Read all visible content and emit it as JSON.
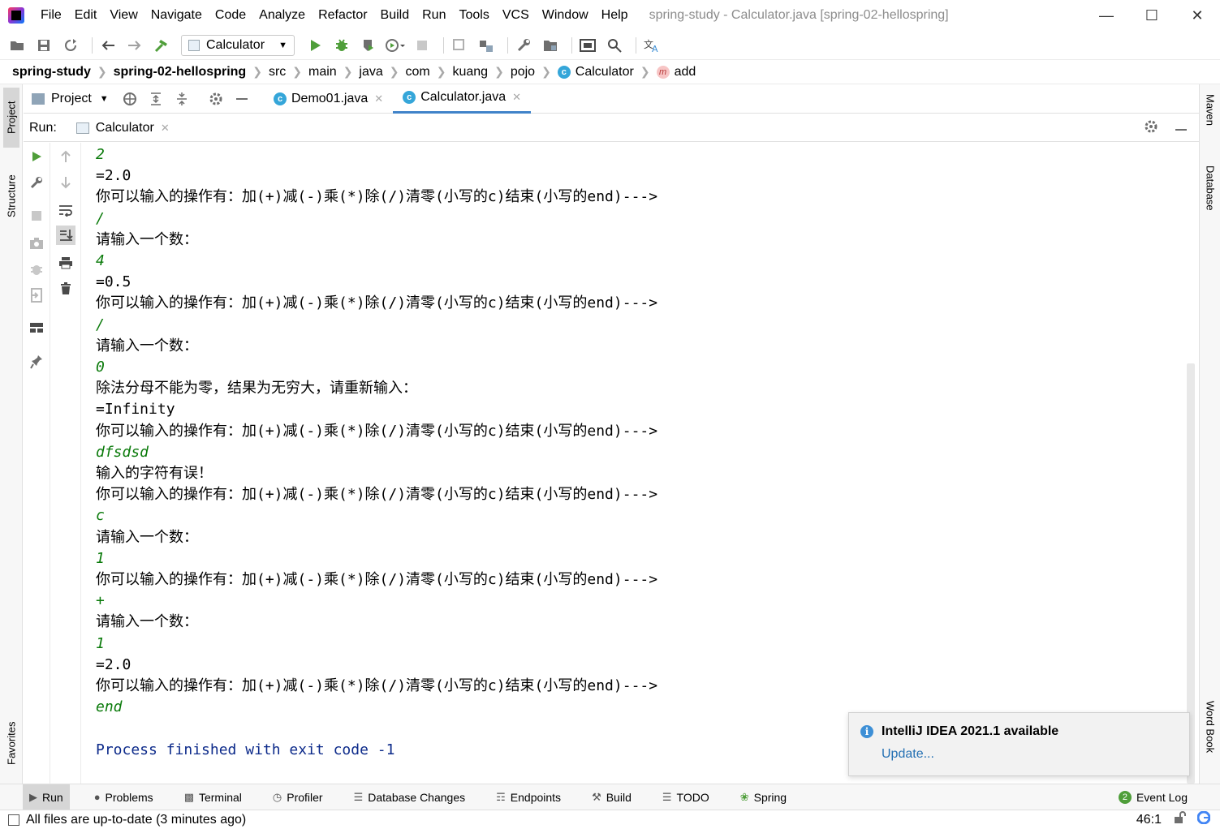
{
  "menu": [
    "File",
    "Edit",
    "View",
    "Navigate",
    "Code",
    "Analyze",
    "Refactor",
    "Build",
    "Run",
    "Tools",
    "VCS",
    "Window",
    "Help"
  ],
  "window_title": "spring-study - Calculator.java [spring-02-hellospring]",
  "toolbar": {
    "run_config": "Calculator"
  },
  "breadcrumb": [
    "spring-study",
    "spring-02-hellospring",
    "src",
    "main",
    "java",
    "com",
    "kuang",
    "pojo",
    "Calculator",
    "add"
  ],
  "left_stripe": {
    "project": "Project",
    "structure": "Structure",
    "favorites": "Favorites"
  },
  "right_stripe": {
    "maven": "Maven",
    "database": "Database",
    "word_book": "Word Book"
  },
  "tabs_row": {
    "project_label": "Project",
    "tabs": [
      "Demo01.java",
      "Calculator.java"
    ]
  },
  "run_header": {
    "label": "Run:",
    "tab": "Calculator"
  },
  "console": [
    {
      "t": "2",
      "k": "in"
    },
    {
      "t": "=2.0",
      "k": "out"
    },
    {
      "t": "你可以输入的操作有：加(+)减(-)乘(*)除(/)清零(小写的c)结束(小写的end)--->",
      "k": "out"
    },
    {
      "t": "/",
      "k": "in"
    },
    {
      "t": "请输入一个数：",
      "k": "out"
    },
    {
      "t": "4",
      "k": "in"
    },
    {
      "t": "=0.5",
      "k": "out"
    },
    {
      "t": "你可以输入的操作有：加(+)减(-)乘(*)除(/)清零(小写的c)结束(小写的end)--->",
      "k": "out"
    },
    {
      "t": "/",
      "k": "in"
    },
    {
      "t": "请输入一个数：",
      "k": "out"
    },
    {
      "t": "0",
      "k": "in"
    },
    {
      "t": "除法分母不能为零，结果为无穷大，请重新输入：",
      "k": "out"
    },
    {
      "t": "=Infinity",
      "k": "out"
    },
    {
      "t": "你可以输入的操作有：加(+)减(-)乘(*)除(/)清零(小写的c)结束(小写的end)--->",
      "k": "out"
    },
    {
      "t": "dfsdsd",
      "k": "in"
    },
    {
      "t": "输入的字符有误！",
      "k": "out"
    },
    {
      "t": "你可以输入的操作有：加(+)减(-)乘(*)除(/)清零(小写的c)结束(小写的end)--->",
      "k": "out"
    },
    {
      "t": "c",
      "k": "in"
    },
    {
      "t": "请输入一个数：",
      "k": "out"
    },
    {
      "t": "1",
      "k": "in"
    },
    {
      "t": "你可以输入的操作有：加(+)减(-)乘(*)除(/)清零(小写的c)结束(小写的end)--->",
      "k": "out"
    },
    {
      "t": "+",
      "k": "in"
    },
    {
      "t": "请输入一个数：",
      "k": "out"
    },
    {
      "t": "1",
      "k": "in"
    },
    {
      "t": "=2.0",
      "k": "out"
    },
    {
      "t": "你可以输入的操作有：加(+)减(-)乘(*)除(/)清零(小写的c)结束(小写的end)--->",
      "k": "out"
    },
    {
      "t": "end",
      "k": "in"
    },
    {
      "t": "",
      "k": "out"
    },
    {
      "t": "Process finished with exit code -1",
      "k": "sys"
    }
  ],
  "notification": {
    "title": "IntelliJ IDEA 2021.1 available",
    "link": "Update..."
  },
  "bottom_bar": {
    "items": [
      "Run",
      "Problems",
      "Terminal",
      "Profiler",
      "Database Changes",
      "Endpoints",
      "Build",
      "TODO",
      "Spring"
    ],
    "event_log": "Event Log",
    "event_count": "2"
  },
  "status": {
    "message": "All files are up-to-date (3 minutes ago)",
    "position": "46:1"
  },
  "colors": {
    "accent": "#4083c9",
    "console_input": "#0a7a0a",
    "console_system": "#0c2a8a",
    "link": "#2470b3"
  }
}
